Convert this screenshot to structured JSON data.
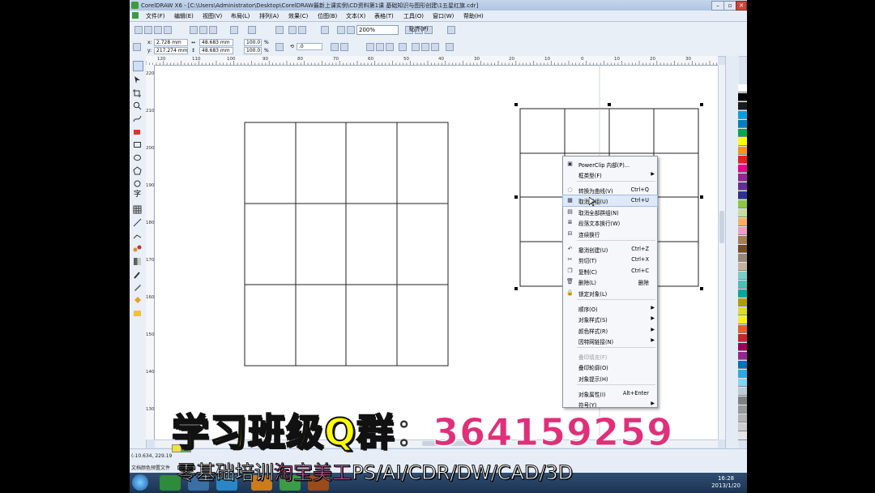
{
  "window": {
    "title": "CorelDRAW X6 - [C:\\Users\\Administrator\\Desktop\\CorelDRAW最新上课实例\\CD资料第1课  基础知识与图形创建\\1五星红旗.cdr]",
    "controls": [
      "–",
      "▫",
      "✕"
    ]
  },
  "menubar": {
    "items": [
      "文件(F)",
      "编辑(E)",
      "视图(V)",
      "布局(L)",
      "排列(A)",
      "效果(C)",
      "位图(B)",
      "文本(X)",
      "表格(T)",
      "工具(O)",
      "窗口(W)",
      "帮助(H)"
    ]
  },
  "toolbar": {
    "zoom_value": "200%",
    "snap_label": "贴齐(P)"
  },
  "propbar": {
    "x_label": "x:",
    "x_value": "2.728 mm",
    "y_label": "y:",
    "y_value": "217.274 mm",
    "w_value": "48.683 mm",
    "h_value": "48.683 mm",
    "scale_x": "100.0",
    "scale_y": "100.0",
    "percent": "%",
    "rotate_value": ".0"
  },
  "hruler": {
    "ticks": [
      "120",
      "110",
      "100",
      "90",
      "80",
      "70",
      "60",
      "50",
      "40",
      "30",
      "20",
      "10",
      "0",
      "10",
      "20",
      "30"
    ]
  },
  "vruler": {
    "ticks": [
      "220",
      "210",
      "200",
      "190",
      "180",
      "170",
      "160",
      "150",
      "140",
      "130"
    ]
  },
  "context_menu": {
    "items": [
      {
        "label": "PowerClip 内部(P)...",
        "shortcut": "",
        "submenu": false,
        "icon": "powerclip-icon"
      },
      {
        "label": "框类型(F)",
        "shortcut": "",
        "submenu": true,
        "icon": ""
      },
      {
        "label": "转换为曲线(V)",
        "shortcut": "Ctrl+Q",
        "submenu": false,
        "icon": "convert-curve-icon"
      },
      {
        "label": "取消群组(U)",
        "shortcut": "Ctrl+U",
        "submenu": false,
        "icon": "ungroup-icon"
      },
      {
        "label": "取消全部群组(N)",
        "shortcut": "",
        "submenu": false,
        "icon": "ungroup-all-icon"
      },
      {
        "label": "段落文本换行(W)",
        "shortcut": "",
        "submenu": false,
        "icon": "text-wrap-icon"
      },
      {
        "label": "连续换行",
        "shortcut": "",
        "submenu": false,
        "icon": "continuous-wrap-icon"
      },
      {
        "label": "撤消创建(U)",
        "shortcut": "Ctrl+Z",
        "submenu": false,
        "icon": "undo-icon"
      },
      {
        "label": "剪切(T)",
        "shortcut": "Ctrl+X",
        "submenu": false,
        "icon": "cut-icon"
      },
      {
        "label": "复制(C)",
        "shortcut": "Ctrl+C",
        "submenu": false,
        "icon": "copy-icon"
      },
      {
        "label": "删除(L)",
        "shortcut": "删除",
        "submenu": false,
        "icon": "delete-icon"
      },
      {
        "label": "锁定对象(L)",
        "shortcut": "",
        "submenu": false,
        "icon": "lock-icon"
      },
      {
        "label": "顺序(O)",
        "shortcut": "",
        "submenu": true,
        "icon": ""
      },
      {
        "label": "对象样式(S)",
        "shortcut": "",
        "submenu": true,
        "icon": ""
      },
      {
        "label": "颜色样式(R)",
        "shortcut": "",
        "submenu": true,
        "icon": ""
      },
      {
        "label": "因特网链接(N)",
        "shortcut": "",
        "submenu": true,
        "icon": ""
      },
      {
        "label": "叠印填充(F)",
        "shortcut": "",
        "submenu": false,
        "icon": "",
        "disabled": true
      },
      {
        "label": "叠印轮廓(O)",
        "shortcut": "",
        "submenu": false,
        "icon": ""
      },
      {
        "label": "对象提示(H)",
        "shortcut": "",
        "submenu": false,
        "icon": ""
      },
      {
        "label": "对象属性(I)",
        "shortcut": "Alt+Enter",
        "submenu": false,
        "icon": ""
      },
      {
        "label": "符号(Y)",
        "shortcut": "",
        "submenu": true,
        "icon": ""
      }
    ]
  },
  "statusbar": {
    "coords": "(-10.634, 229.19",
    "doc_info": "文档颜色预置文件"
  },
  "taskbar": {
    "time": "16:28",
    "date": "2013/1/20"
  },
  "overlay": {
    "label": "学习班级Q群",
    "colon": "：",
    "number": "364159259",
    "line2_a": "零基础培训",
    "line2_b": "淘宝美工",
    "line2_c": "PS/AI/CDR/DW/CAD/3D"
  },
  "colors": {
    "palette": [
      "#ffffff",
      "#000000",
      "#1a1a1a",
      "#00a0e0",
      "#0080c0",
      "#00a651",
      "#ffff00",
      "#f7941d",
      "#ed1c24",
      "#ec008c",
      "#92278f",
      "#662d91",
      "#2e3192",
      "#8dc63f",
      "#c4df9b",
      "#fbaf5d",
      "#f49ac1",
      "#a67c52",
      "#754c24",
      "#998675",
      "#c7b299",
      "#7accc8",
      "#4cbeb4",
      "#00a99d",
      "#aba000",
      "#d9e021",
      "#fcee21",
      "#f15a24",
      "#c1272d",
      "#9e005d",
      "#93278f",
      "#0071bc",
      "#29abe2",
      "#7fd6f7",
      "#bdccd4",
      "#808080",
      "#999999",
      "#b3b3b3",
      "#cccccc",
      "#e6e6e6"
    ]
  }
}
